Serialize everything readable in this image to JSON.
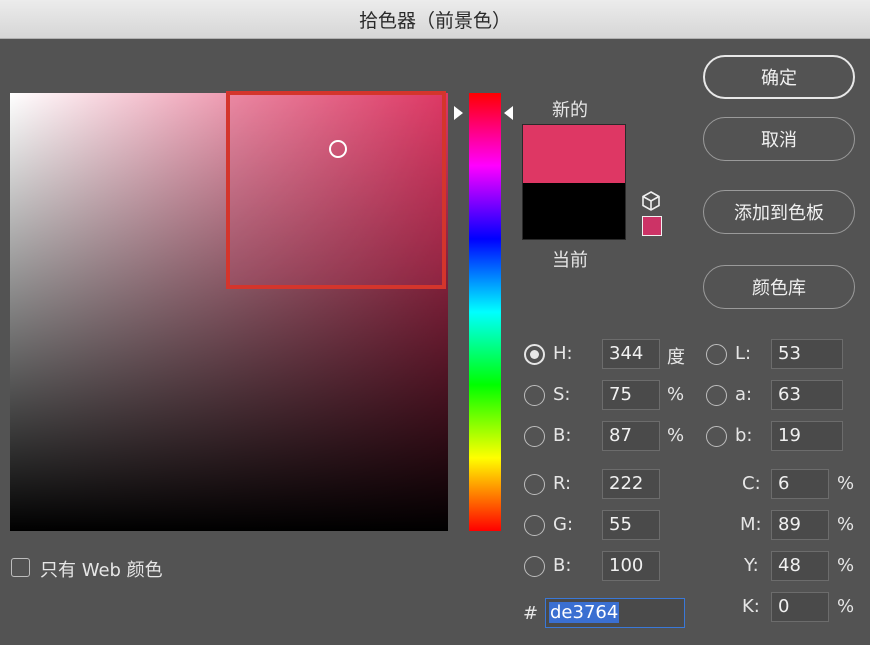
{
  "window": {
    "title": "拾色器（前景色）"
  },
  "colors": {
    "new": "#de3764",
    "current": "#000000",
    "websafe": "#cc3366",
    "highlight_box": "#d4352c",
    "hex_selection": "#3a6fd1"
  },
  "swatch": {
    "new_label": "新的",
    "current_label": "当前"
  },
  "buttons": {
    "ok": "确定",
    "cancel": "取消",
    "add_to_swatches": "添加到色板",
    "color_libraries": "颜色库"
  },
  "hsb": {
    "h": {
      "label": "H:",
      "value": "344",
      "unit": "度",
      "selected": true
    },
    "s": {
      "label": "S:",
      "value": "75",
      "unit": "%"
    },
    "b": {
      "label": "B:",
      "value": "87",
      "unit": "%"
    }
  },
  "lab": {
    "l": {
      "label": "L:",
      "value": "53"
    },
    "a": {
      "label": "a:",
      "value": "63"
    },
    "b": {
      "label": "b:",
      "value": "19"
    }
  },
  "rgb": {
    "r": {
      "label": "R:",
      "value": "222"
    },
    "g": {
      "label": "G:",
      "value": "55"
    },
    "b": {
      "label": "B:",
      "value": "100"
    }
  },
  "cmyk": {
    "c": {
      "label": "C:",
      "value": "6",
      "unit": "%"
    },
    "m": {
      "label": "M:",
      "value": "89",
      "unit": "%"
    },
    "y": {
      "label": "Y:",
      "value": "48",
      "unit": "%"
    },
    "k": {
      "label": "K:",
      "value": "0",
      "unit": "%"
    }
  },
  "hex": {
    "label": "#",
    "value": "de3764"
  },
  "web_only": {
    "label": "只有 Web 颜色",
    "checked": false
  }
}
